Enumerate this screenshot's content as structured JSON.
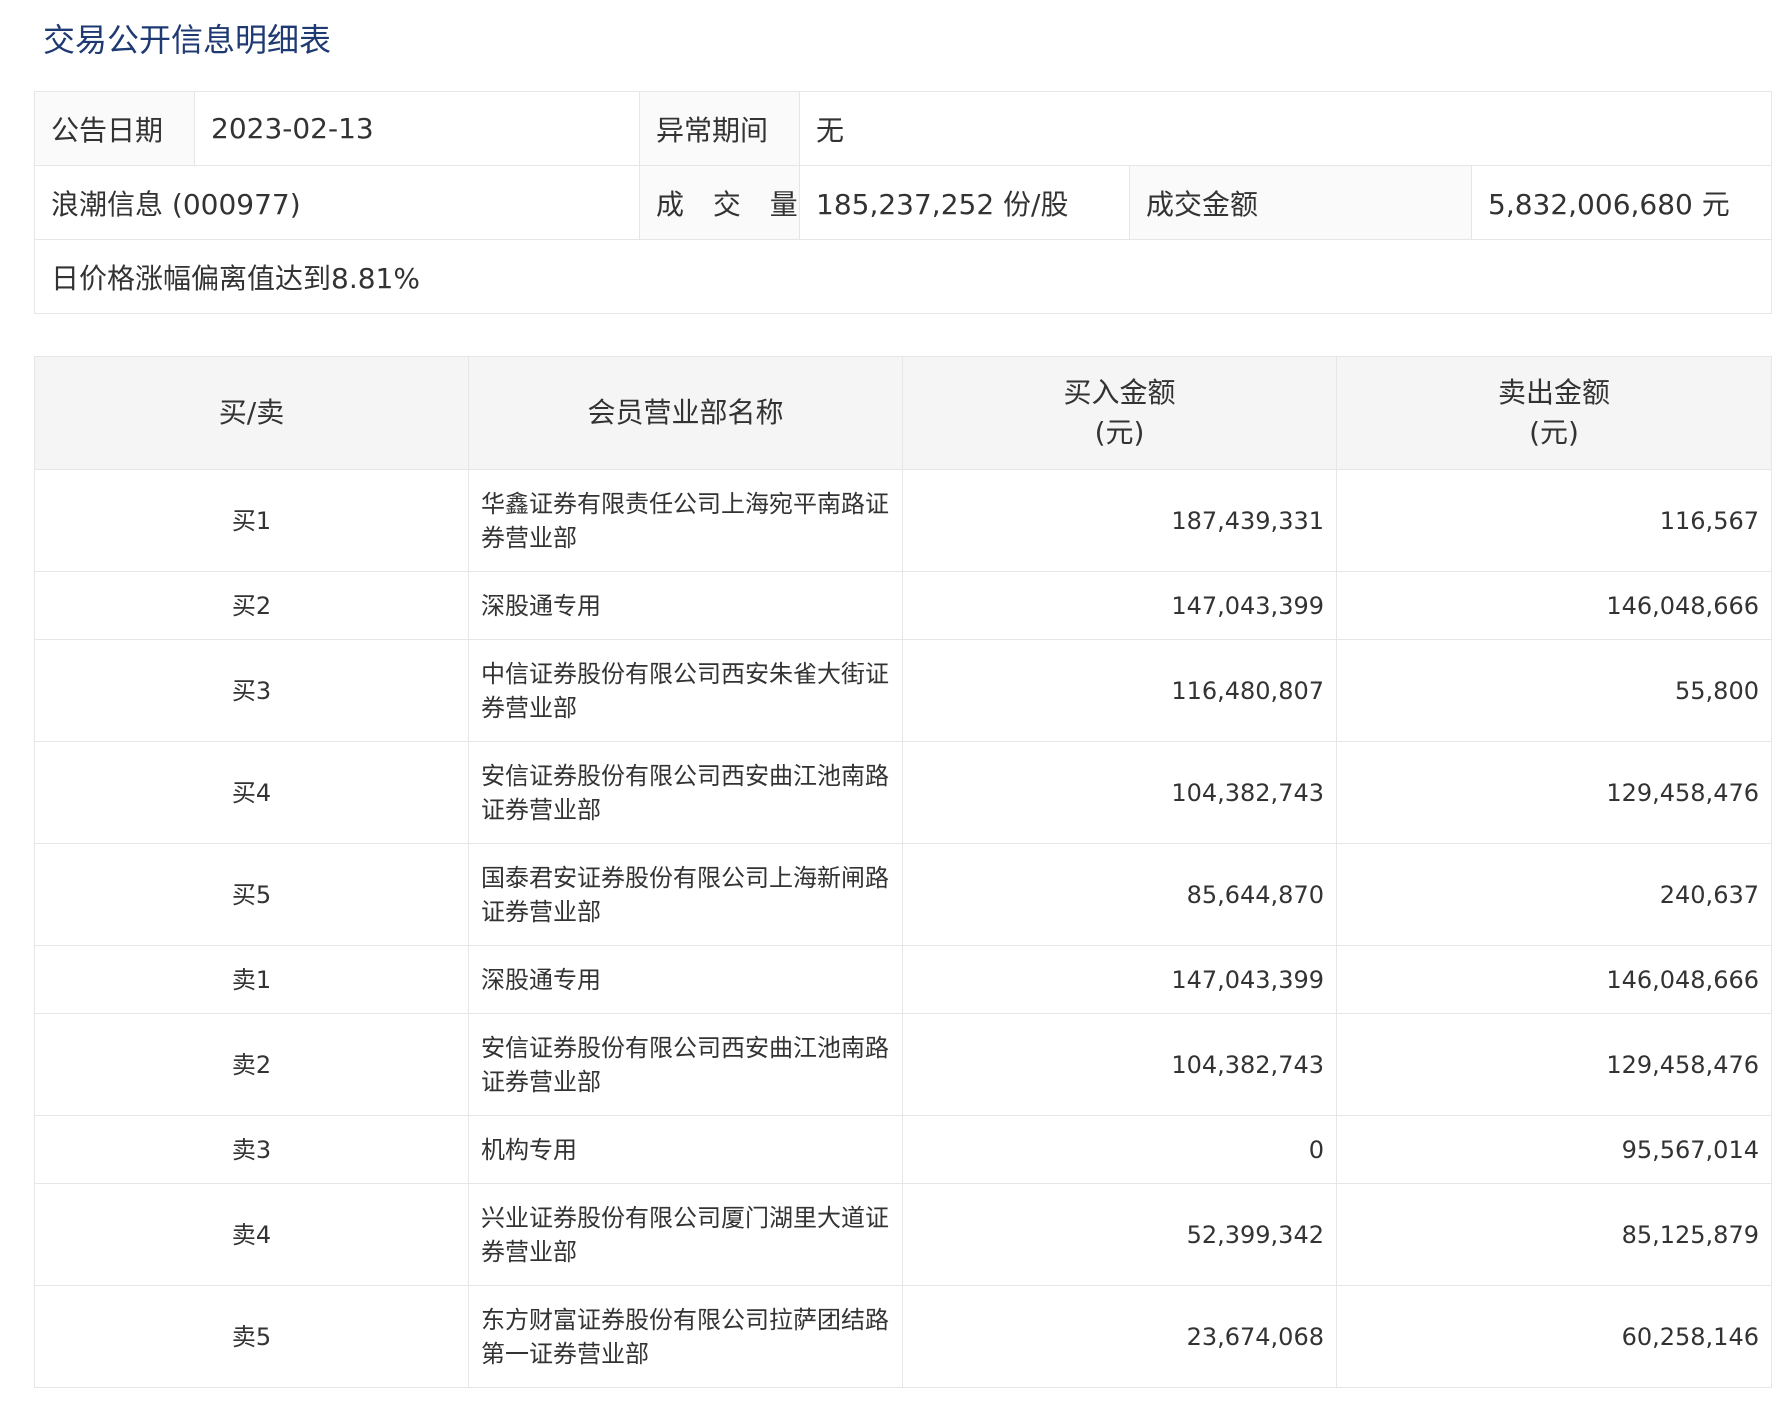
{
  "page": {
    "title": "交易公开信息明细表"
  },
  "info": {
    "announce_date_label": "公告日期",
    "announce_date_value": "2023-02-13",
    "abnormal_period_label": "异常期间",
    "abnormal_period_value": "无",
    "stock_name": "浪潮信息 (000977)",
    "volume_label": "成 交 量",
    "volume_value": "185,237,252 份/股",
    "amount_label": "成交金额",
    "amount_value": "5,832,006,680 元",
    "reason": "日价格涨幅偏离值达到8.81%"
  },
  "table": {
    "headers": {
      "type": "买/卖",
      "name": "会员营业部名称",
      "buy_line1": "买入金额",
      "buy_line2": "(元)",
      "sell_line1": "卖出金额",
      "sell_line2": "(元)"
    },
    "rows": [
      {
        "type": "买1",
        "name": "华鑫证券有限责任公司上海宛平南路证券营业部",
        "buy": "187,439,331",
        "sell": "116,567"
      },
      {
        "type": "买2",
        "name": "深股通专用",
        "buy": "147,043,399",
        "sell": "146,048,666"
      },
      {
        "type": "买3",
        "name": "中信证券股份有限公司西安朱雀大街证券营业部",
        "buy": "116,480,807",
        "sell": "55,800"
      },
      {
        "type": "买4",
        "name": "安信证券股份有限公司西安曲江池南路证券营业部",
        "buy": "104,382,743",
        "sell": "129,458,476"
      },
      {
        "type": "买5",
        "name": "国泰君安证券股份有限公司上海新闸路证券营业部",
        "buy": "85,644,870",
        "sell": "240,637"
      },
      {
        "type": "卖1",
        "name": "深股通专用",
        "buy": "147,043,399",
        "sell": "146,048,666"
      },
      {
        "type": "卖2",
        "name": "安信证券股份有限公司西安曲江池南路证券营业部",
        "buy": "104,382,743",
        "sell": "129,458,476"
      },
      {
        "type": "卖3",
        "name": "机构专用",
        "buy": "0",
        "sell": "95,567,014"
      },
      {
        "type": "卖4",
        "name": "兴业证券股份有限公司厦门湖里大道证券营业部",
        "buy": "52,399,342",
        "sell": "85,125,879"
      },
      {
        "type": "卖5",
        "name": "东方财富证券股份有限公司拉萨团结路第一证券营业部",
        "buy": "23,674,068",
        "sell": "60,258,146"
      }
    ]
  }
}
